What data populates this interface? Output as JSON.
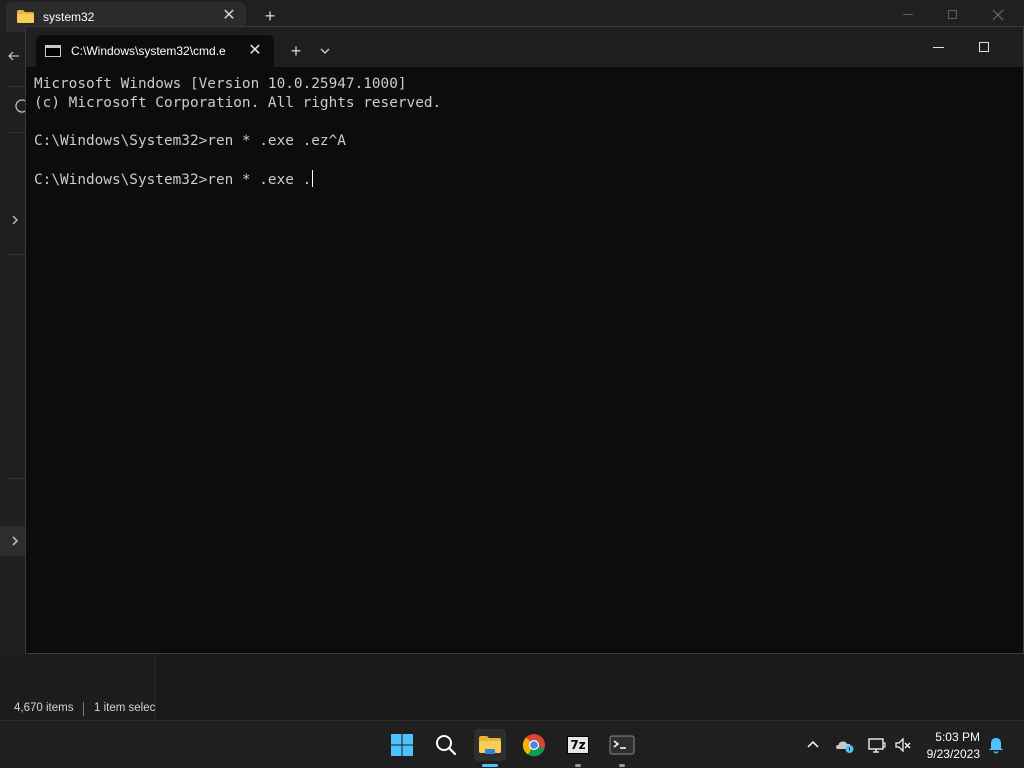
{
  "explorer": {
    "tab_title": "system32",
    "tab_close": "✕",
    "new_tab": "+",
    "status_items": "4,670 items",
    "status_selected": "1 item selec"
  },
  "terminal": {
    "tab_title": "C:\\Windows\\system32\\cmd.e",
    "tab_close": "✕",
    "new_tab": "+",
    "lines": [
      "Microsoft Windows [Version 10.0.25947.1000]",
      "(c) Microsoft Corporation. All rights reserved.",
      "",
      "C:\\Windows\\System32>ren * .exe .ez^A",
      "",
      "C:\\Windows\\System32>ren * .exe ."
    ]
  },
  "taskbar": {
    "apps": [
      "start-icon",
      "search-icon",
      "file-explorer-icon",
      "chrome-icon",
      "7zip-icon",
      "terminal-icon"
    ],
    "sevenzip_label": "7z",
    "clock_time": "5:03 PM",
    "clock_date": "9/23/2023"
  },
  "colors": {
    "terminal_bg": "#0c0c0c",
    "terminal_text": "#cccccc",
    "taskbar_bg": "#1f1f1f",
    "accent": "#4cc2ff"
  }
}
